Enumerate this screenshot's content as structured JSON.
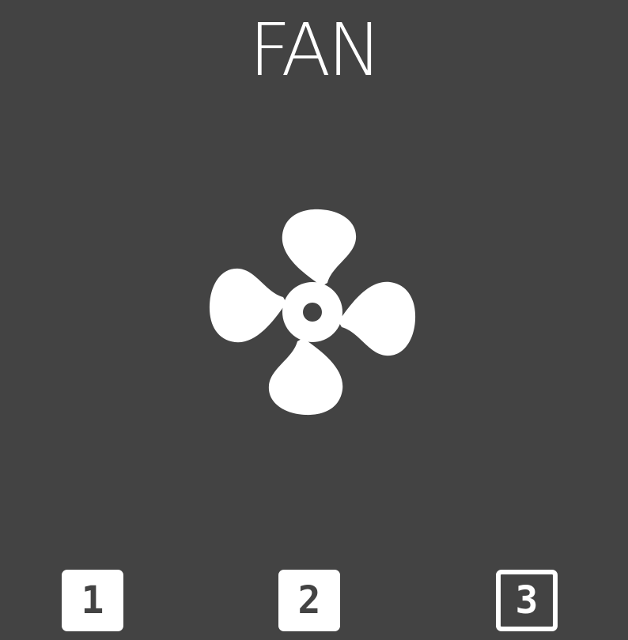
{
  "header": {
    "title": "FAN"
  },
  "fan": {
    "icon": "fan-icon"
  },
  "speeds": [
    {
      "label": "1",
      "selected": false
    },
    {
      "label": "2",
      "selected": false
    },
    {
      "label": "3",
      "selected": true
    }
  ],
  "colors": {
    "background": "#434343",
    "foreground": "#ffffff"
  }
}
